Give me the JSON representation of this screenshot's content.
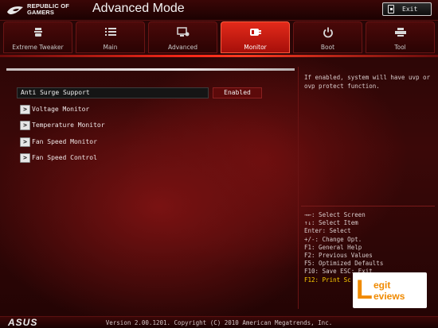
{
  "header": {
    "brand_line1": "REPUBLIC OF",
    "brand_line2": "GAMERS",
    "title": "Advanced Mode",
    "exit_label": "Exit"
  },
  "tabs": [
    {
      "label": "Extreme Tweaker",
      "icon": "tweaker-icon",
      "active": false
    },
    {
      "label": "Main",
      "icon": "list-icon",
      "active": false
    },
    {
      "label": "Advanced",
      "icon": "advanced-icon",
      "active": false
    },
    {
      "label": "Monitor",
      "icon": "monitor-icon",
      "active": true
    },
    {
      "label": "Boot",
      "icon": "power-icon",
      "active": false
    },
    {
      "label": "Tool",
      "icon": "printer-icon",
      "active": false
    }
  ],
  "main": {
    "setting": {
      "label": "Anti Surge Support",
      "value": "Enabled"
    },
    "submenus": [
      {
        "label": "Voltage Monitor"
      },
      {
        "label": "Temperature Monitor"
      },
      {
        "label": "Fan Speed Monitor"
      },
      {
        "label": "Fan Speed Control"
      }
    ]
  },
  "help": {
    "text": "If enabled, system will have uvp or ovp protect function."
  },
  "keys": [
    "→←: Select Screen",
    "↑↓: Select Item",
    "Enter: Select",
    "+/-: Change Opt.",
    "F1: General Help",
    "F2: Previous Values",
    "F5: Optimized Defaults",
    "F10: Save  ESC: Exit",
    "F12: Print Sc"
  ],
  "watermark": {
    "letter": "L",
    "word1": "egit",
    "word2": "eviews"
  },
  "footer": {
    "brand": "ASUS",
    "version": "Version 2.00.1201. Copyright (C) 2010 American Megatrends, Inc."
  },
  "colors": {
    "accent_red": "#e32a1a",
    "highlight_key": "#ffd000"
  }
}
